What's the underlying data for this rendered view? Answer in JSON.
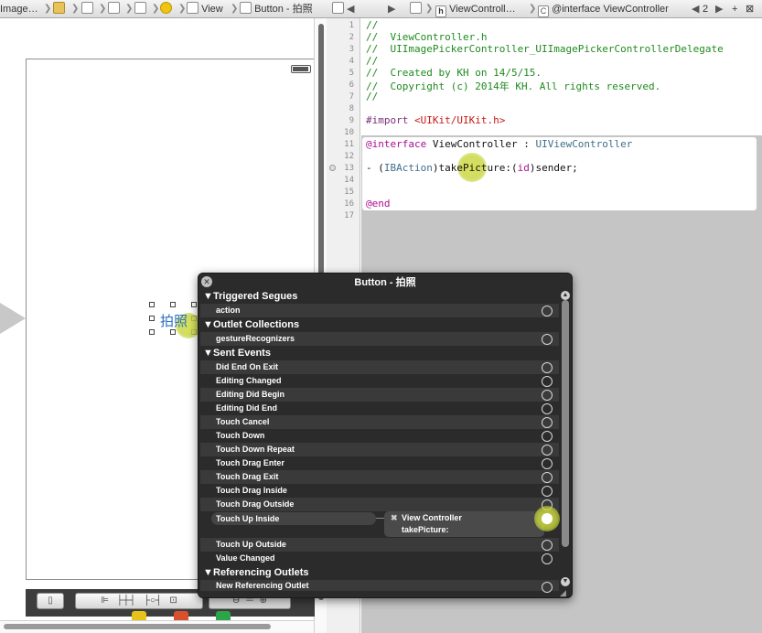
{
  "jumpbar": {
    "crumb1": "Image…",
    "crumb_view": "View",
    "crumb_button": "Button - 拍照",
    "file": "ViewControll…",
    "symbol": "@interface ViewController",
    "counter": "2",
    "back": "◀",
    "forward": "▶",
    "add": "+",
    "close": "⊠"
  },
  "canvas": {
    "button_label": "拍照"
  },
  "editor": {
    "line_numbers": [
      "1",
      "2",
      "3",
      "4",
      "5",
      "6",
      "7",
      "8",
      "9",
      "10",
      "11",
      "12",
      "13",
      "14",
      "15",
      "16",
      "17"
    ],
    "lines": {
      "l1": "//",
      "l2": "//  ViewController.h",
      "l3": "//  UIImagePickerController_UIImagePickerControllerDelegate",
      "l4": "//",
      "l5": "//  Created by KH on 14/5/15.",
      "l6": "//  Copyright (c) 2014年 KH. All rights reserved.",
      "l7": "//",
      "l9_kw": "#import ",
      "l9_str": "<UIKit/UIKit.h>",
      "l11_kw": "@interface",
      "l11_name": " ViewController : ",
      "l11_super": "UIViewController",
      "l13_dash": "- (",
      "l13_type": "IBAction",
      "l13_mid": ")takePicture:(",
      "l13_id": "id",
      "l13_end": ")sender;",
      "l16": "@end"
    }
  },
  "hud": {
    "title": "Button - 拍照",
    "close": "✕",
    "triggered_segues": "Triggered Segues",
    "action": "action",
    "outlet_collections": "Outlet Collections",
    "gesture_recognizers": "gestureRecognizers",
    "sent_events": "Sent Events",
    "events": [
      "Did End On Exit",
      "Editing Changed",
      "Editing Did Begin",
      "Editing Did End",
      "Touch Cancel",
      "Touch Down",
      "Touch Down Repeat",
      "Touch Drag Enter",
      "Touch Drag Exit",
      "Touch Drag Inside",
      "Touch Drag Outside",
      "Touch Up Inside",
      "Touch Up Outside",
      "Value Changed"
    ],
    "connection_target": "View Controller",
    "connection_action": "takePicture:",
    "connection_remove": "✖",
    "referencing_outlets": "Referencing Outlets",
    "new_referencing_outlet": "New Referencing Outlet",
    "triangle": "▼"
  }
}
